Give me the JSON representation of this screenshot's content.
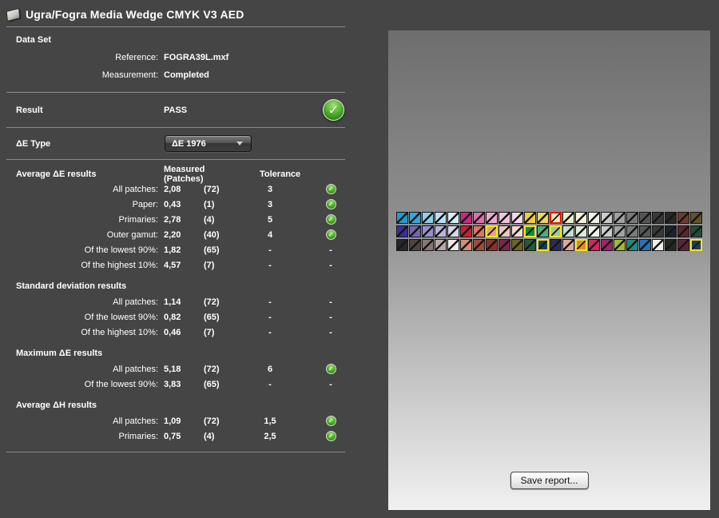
{
  "title": "Ugra/Fogra Media Wedge CMYK V3 AED",
  "data_set": {
    "heading": "Data Set",
    "rows": [
      {
        "label": "Reference:",
        "value": "FOGRA39L.mxf"
      },
      {
        "label": "Measurement:",
        "value": "Completed"
      }
    ]
  },
  "result": {
    "label": "Result",
    "value": "PASS",
    "status": "pass"
  },
  "de_type": {
    "label": "ΔE Type",
    "selected": "ΔE 1976"
  },
  "table": {
    "col_measured": "Measured (Patches)",
    "col_tolerance": "Tolerance",
    "sections": [
      {
        "heading": "Average ΔE results",
        "show_columns": true,
        "rows": [
          {
            "label": "All patches:",
            "measured": "2,08",
            "patches": "(72)",
            "tolerance": "3",
            "status": "pass"
          },
          {
            "label": "Paper:",
            "measured": "0,43",
            "patches": "(1)",
            "tolerance": "3",
            "status": "pass"
          },
          {
            "label": "Primaries:",
            "measured": "2,78",
            "patches": "(4)",
            "tolerance": "5",
            "status": "pass"
          },
          {
            "label": "Outer gamut:",
            "measured": "2,20",
            "patches": "(40)",
            "tolerance": "4",
            "status": "pass"
          },
          {
            "label": "Of the lowest 90%:",
            "measured": "1,82",
            "patches": "(65)",
            "tolerance": "-",
            "status": "dash"
          },
          {
            "label": "Of the highest 10%:",
            "measured": "4,57",
            "patches": "(7)",
            "tolerance": "-",
            "status": "dash"
          }
        ]
      },
      {
        "heading": "Standard deviation results",
        "show_columns": false,
        "rows": [
          {
            "label": "All patches:",
            "measured": "1,14",
            "patches": "(72)",
            "tolerance": "-",
            "status": "dash"
          },
          {
            "label": "Of the lowest 90%:",
            "measured": "0,82",
            "patches": "(65)",
            "tolerance": "-",
            "status": "dash"
          },
          {
            "label": "Of the highest 10%:",
            "measured": "0,46",
            "patches": "(7)",
            "tolerance": "-",
            "status": "dash"
          }
        ]
      },
      {
        "heading": "Maximum ΔE results",
        "show_columns": false,
        "rows": [
          {
            "label": "All patches:",
            "measured": "5,18",
            "patches": "(72)",
            "tolerance": "6",
            "status": "pass"
          },
          {
            "label": "Of the lowest 90%:",
            "measured": "3,83",
            "patches": "(65)",
            "tolerance": "-",
            "status": "dash"
          }
        ]
      },
      {
        "heading": "Average ΔH results",
        "show_columns": false,
        "rows": [
          {
            "label": "All patches:",
            "measured": "1,09",
            "patches": "(72)",
            "tolerance": "1,5",
            "status": "pass"
          },
          {
            "label": "Primaries:",
            "measured": "0,75",
            "patches": "(4)",
            "tolerance": "2,5",
            "status": "pass"
          }
        ]
      }
    ]
  },
  "wedge": {
    "rows": [
      [
        {
          "color": "#1E9CD2"
        },
        {
          "color": "#33A9DB"
        },
        {
          "color": "#8FCEE9"
        },
        {
          "color": "#BCDFF1"
        },
        {
          "color": "#D8EBF5"
        },
        {
          "color": "#C9297E"
        },
        {
          "color": "#DC70AC"
        },
        {
          "color": "#EBA9CE"
        },
        {
          "color": "#F0C5DC"
        },
        {
          "color": "#F3D9E6"
        },
        {
          "color": "#EFCF35"
        },
        {
          "color": "#EDD55F"
        },
        {
          "color": "#F2E7B2",
          "hl": "red"
        },
        {
          "color": "#F2ECCA"
        },
        {
          "color": "#F4F0DC"
        },
        {
          "color": "#F0F0E8"
        },
        {
          "color": "#CACACA"
        },
        {
          "color": "#A0A0A0"
        },
        {
          "color": "#787878"
        },
        {
          "color": "#555555"
        },
        {
          "color": "#3A3A3A"
        },
        {
          "color": "#2B2725"
        },
        {
          "color": "#6C3B2F"
        },
        {
          "color": "#5D5427"
        }
      ],
      [
        {
          "color": "#37309A"
        },
        {
          "color": "#6F66B6"
        },
        {
          "color": "#9690CC"
        },
        {
          "color": "#B9B5DC"
        },
        {
          "color": "#D8D6EB"
        },
        {
          "color": "#C52134"
        },
        {
          "color": "#DB7461"
        },
        {
          "color": "#E89F8C",
          "hl": "yellow"
        },
        {
          "color": "#F0C5BD"
        },
        {
          "color": "#F3DCD7"
        },
        {
          "color": "#118B46",
          "hl": "yellow"
        },
        {
          "color": "#55AC73"
        },
        {
          "color": "#97CCA6",
          "hl": "yellow"
        },
        {
          "color": "#C1E1C9"
        },
        {
          "color": "#DBEEDE"
        },
        {
          "color": "#EDF2EB"
        },
        {
          "color": "#C8CCCA"
        },
        {
          "color": "#A0A4A2"
        },
        {
          "color": "#777B79"
        },
        {
          "color": "#535755"
        },
        {
          "color": "#373B39"
        },
        {
          "color": "#1B2531"
        },
        {
          "color": "#5D2531"
        },
        {
          "color": "#204B39"
        }
      ],
      [
        {
          "color": "#272727"
        },
        {
          "color": "#50433D"
        },
        {
          "color": "#867773"
        },
        {
          "color": "#B6A9A5"
        },
        {
          "color": "#EEEBE7"
        },
        {
          "color": "#DA8B75"
        },
        {
          "color": "#9F4B39"
        },
        {
          "color": "#8B3129"
        },
        {
          "color": "#7B2546"
        },
        {
          "color": "#6F6521"
        },
        {
          "color": "#205B3B"
        },
        {
          "color": "#1B3B53",
          "hl": "yellow"
        },
        {
          "color": "#2B2B53"
        },
        {
          "color": "#DDA997"
        },
        {
          "color": "#E18B29",
          "hl": "yellow"
        },
        {
          "color": "#D52663"
        },
        {
          "color": "#9F2369"
        },
        {
          "color": "#9FB933"
        },
        {
          "color": "#1F8B81"
        },
        {
          "color": "#2573B9"
        },
        {
          "color": "#F1EFEB"
        },
        {
          "color": "#23291F"
        },
        {
          "color": "#5B2539"
        },
        {
          "color": "#1F3B5B",
          "hl": "yellow"
        }
      ]
    ]
  },
  "save_button": "Save report...",
  "colors": {
    "pass_green": "#3f9c22",
    "highlight_red": "#e51400",
    "highlight_yellow": "#f2e619",
    "background": "#454545"
  }
}
